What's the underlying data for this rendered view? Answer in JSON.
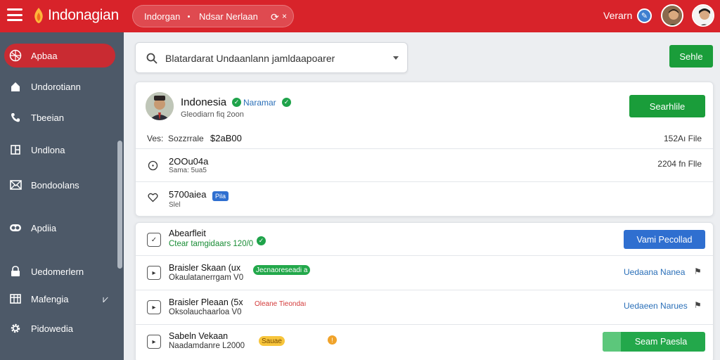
{
  "topbar": {
    "brand": "Indonagian",
    "pill_left": "Indorgan",
    "pill_right": "Ndsar Nerlaan",
    "user_name": "Verarn",
    "accent": "#d8232a"
  },
  "search": {
    "value": "Blatardarat Undaanlann jamldaapoarer",
    "icon": "search-icon"
  },
  "actions": {
    "top_button": "Sehle"
  },
  "sidebar": {
    "items": [
      {
        "label": "Apbaa",
        "icon": "globe-icon",
        "active": true
      },
      {
        "label": "Undorotiann",
        "icon": "home-icon"
      },
      {
        "label": "Tbeeian",
        "icon": "phone-icon"
      },
      {
        "label": "Undlona",
        "icon": "grid-icon"
      },
      {
        "label": "Bondoolans",
        "icon": "mail-icon"
      },
      {
        "label": "Apdiia",
        "icon": "toggle-icon"
      },
      {
        "label": "Uedomerlern",
        "icon": "lock-icon"
      },
      {
        "label": "Mafengia",
        "icon": "table-icon",
        "extra": "check-icon"
      },
      {
        "label": "Pidowedia",
        "icon": "gear-icon"
      }
    ]
  },
  "profile": {
    "name": "Indonesia",
    "tag": "Naramar",
    "subtitle": "Gleodiarn fiq 2oon",
    "button": "Searhlile",
    "vs_label": "Ves:",
    "vs_name": "Sozzrrale",
    "vs_value": "$2aB00",
    "vs_right": "152Aı File",
    "rows": [
      {
        "title": "2OOu04a",
        "meta": "Sama: 5ua5",
        "right": "2204 fn Flle",
        "icon": "clock-icon"
      },
      {
        "title": "5700aiea",
        "meta": "Slel",
        "badge": "Pila",
        "icon": "heart-icon"
      }
    ]
  },
  "list": [
    {
      "title": "Abearfleit",
      "meta": "Ctear tamgidaars 120/0",
      "meta_color": "#1a8d36",
      "button": "Vami Pecollad",
      "button_type": "blue"
    },
    {
      "title": "Braisler Skaan (ux",
      "meta": "Okaulatanerrgam V0",
      "badge": "Jecnaoreseadi a",
      "badge_color": "#23a84b",
      "link": "Uedaana Nanea",
      "flag": "flag-icon"
    },
    {
      "title": "Braisler Pleaan (5x",
      "meta": "Oksolauchaarloa V0",
      "badge": "Oleane Tieondaı",
      "badge_color": "#d33a3a",
      "link": "Uedaeen Narues",
      "flag": "flag-icon"
    },
    {
      "title": "Sabeln Vekaan",
      "meta": "Naadamdanre L2000",
      "badge": "Sauae",
      "badge_color": "#f0b324",
      "button": "Seam Paesla",
      "button_type": "green"
    }
  ]
}
